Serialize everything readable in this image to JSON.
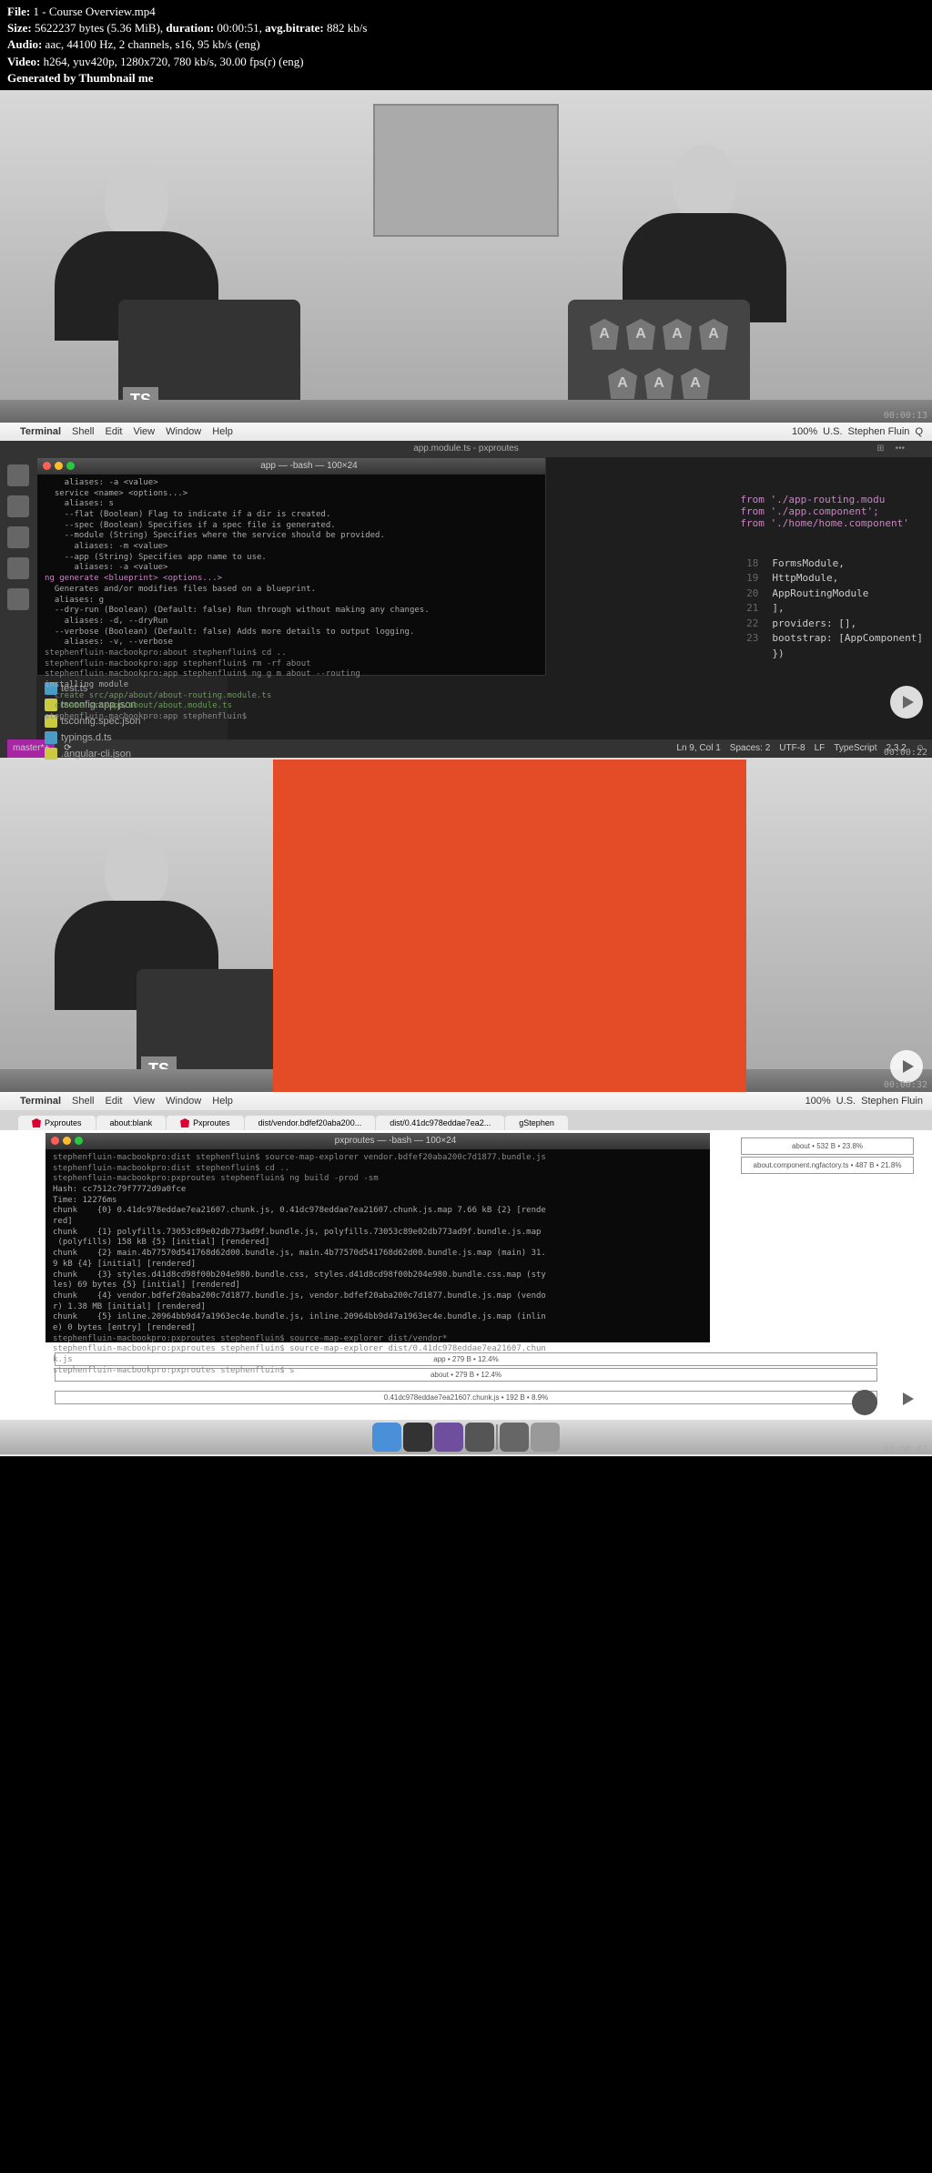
{
  "metadata": {
    "file_label": "File:",
    "file_value": "1 - Course Overview.mp4",
    "size_label": "Size:",
    "size_value": "5622237",
    "size_unit": "bytes (5.36 MiB),",
    "duration_label": "duration:",
    "duration_value": "00:00:51,",
    "avgbitrate_label": "avg.bitrate:",
    "avgbitrate_value": "882 kb/s",
    "audio_label": "Audio:",
    "audio_value": "aac, 44100 Hz, 2 channels, s16, 95 kb/s (eng)",
    "video_label": "Video:",
    "video_value": "h264, yuv420p, 1280x720, 780 kb/s, 30.00 fps(r) (eng)",
    "generated": "Generated by Thumbnail me"
  },
  "timestamps": {
    "f1": "00:00:13",
    "f2": "00:00:22",
    "f3": "00:00:32",
    "f4": "00:00:43"
  },
  "laptop_badges": {
    "ts": "TS",
    "angular": "A"
  },
  "mac_menu": {
    "items": [
      "Terminal",
      "Shell",
      "Edit",
      "View",
      "Window",
      "Help"
    ],
    "right_user": "Stephen Fluin",
    "battery": "100%",
    "flag": "U.S."
  },
  "terminal1": {
    "title": "app — -bash — 100×24",
    "tab_title": "app.module.ts - pxproutes",
    "lines": [
      "    aliases: -a <value>",
      "  service <name> <options...>",
      "    aliases: s",
      "    --flat (Boolean) Flag to indicate if a dir is created.",
      "    --spec (Boolean) Specifies if a spec file is generated.",
      "    --module (String) Specifies where the service should be provided.",
      "      aliases: -m <value>",
      "    --app (String) Specifies app name to use.",
      "      aliases: -a <value>",
      "ng generate <blueprint> <options...>",
      "  Generates and/or modifies files based on a blueprint.",
      "  aliases: g",
      "  --dry-run (Boolean) (Default: false) Run through without making any changes.",
      "    aliases: -d, --dryRun",
      "  --verbose (Boolean) (Default: false) Adds more details to output logging.",
      "    aliases: -v, --verbose",
      "",
      "stephenfluin-macbookpro:about stephenfluin$ cd ..",
      "stephenfluin-macbookpro:app stephenfluin$ rm -rf about",
      "stephenfluin-macbookpro:app stephenfluin$ ng g m about --routing",
      "installing module",
      "  create src/app/about/about-routing.module.ts",
      "  create src/app/about/about.module.ts",
      "stephenfluin-macbookpro:app stephenfluin$ "
    ]
  },
  "file_tree": {
    "items": [
      {
        "icon": "ts",
        "name": "test.ts"
      },
      {
        "icon": "json",
        "name": "tsconfig.app.json"
      },
      {
        "icon": "json",
        "name": "tsconfig.spec.json"
      },
      {
        "icon": "ts",
        "name": "typings.d.ts"
      },
      {
        "icon": "json",
        "name": ".angular-cli.json"
      }
    ]
  },
  "code_editor": {
    "imports": [
      "from './app-routing.modu",
      "from './app.component';",
      "from './home/home.component'"
    ],
    "lines": [
      {
        "num": "18",
        "text": "FormsModule,"
      },
      {
        "num": "19",
        "text": "HttpModule,"
      },
      {
        "num": "20",
        "text": "AppRoutingModule"
      },
      {
        "num": "21",
        "text": "],"
      },
      {
        "num": "22",
        "text": "providers: [],"
      },
      {
        "num": "23",
        "text": "bootstrap: [AppComponent]"
      },
      {
        "num": "",
        "text": "})"
      }
    ]
  },
  "statusbar": {
    "branch": "master*+",
    "position": "Ln 9, Col 1",
    "spaces": "Spaces: 2",
    "encoding": "UTF-8",
    "lineending": "LF",
    "language": "TypeScript",
    "version": "2.3.2"
  },
  "browser_tabs": [
    "Pxproutes",
    "about:blank",
    "Pxproutes",
    "dist/vendor.bdfef20aba200...",
    "dist/0.41dc978eddae7ea2...",
    "gStephen"
  ],
  "terminal2": {
    "title": "pxproutes — -bash — 100×24",
    "lines": [
      "stephenfluin-macbookpro:dist stephenfluin$ source-map-explorer vendor.bdfef20aba200c7d1877.bundle.js",
      "stephenfluin-macbookpro:dist stephenfluin$ cd ..",
      "stephenfluin-macbookpro:pxproutes stephenfluin$ ng build -prod -sm",
      "Hash: cc7512c79f7772d9a0fce",
      "Time: 12276ms",
      "chunk    {0} 0.41dc978eddae7ea21607.chunk.js, 0.41dc978eddae7ea21607.chunk.js.map 7.66 kB {2} [rende",
      "red]",
      "chunk    {1} polyfills.73053c89e02db773ad9f.bundle.js, polyfills.73053c89e02db773ad9f.bundle.js.map",
      " (polyfills) 158 kB {5} [initial] [rendered]",
      "chunk    {2} main.4b77570d541768d62d00.bundle.js, main.4b77570d541768d62d00.bundle.js.map (main) 31.",
      "9 kB {4} [initial] [rendered]",
      "chunk    {3} styles.d41d8cd98f00b204e980.bundle.css, styles.d41d8cd98f00b204e980.bundle.css.map (sty",
      "les) 69 bytes {5} [initial] [rendered]",
      "chunk    {4} vendor.bdfef20aba200c7d1877.bundle.js, vendor.bdfef20aba200c7d1877.bundle.js.map (vendo",
      "r) 1.38 MB [initial] [rendered]",
      "chunk    {5} inline.20964bb9d47a1963ec4e.bundle.js, inline.20964bb9d47a1963ec4e.bundle.js.map (inlin",
      "e) 0 bytes [entry] [rendered]",
      "stephenfluin-macbookpro:pxproutes stephenfluin$ source-map-explorer dist/vendor*",
      "stephenfluin-macbookpro:pxproutes stephenfluin$ source-map-explorer dist/0.41dc978eddae7ea21607.chun",
      "k.js",
      "stephenfluin-macbookpro:pxproutes stephenfluin$ s"
    ]
  },
  "sourcemap": {
    "side_boxes": [
      "about • 532 B • 23.8%",
      "about.component.ngfactory.ts • 487 B • 21.8%"
    ],
    "bottom_boxes": [
      "app • 279 B • 12.4%",
      "about • 279 B • 12.4%",
      "0.41dc978eddae7ea21607.chunk.js • 192 B • 8.9%"
    ]
  }
}
